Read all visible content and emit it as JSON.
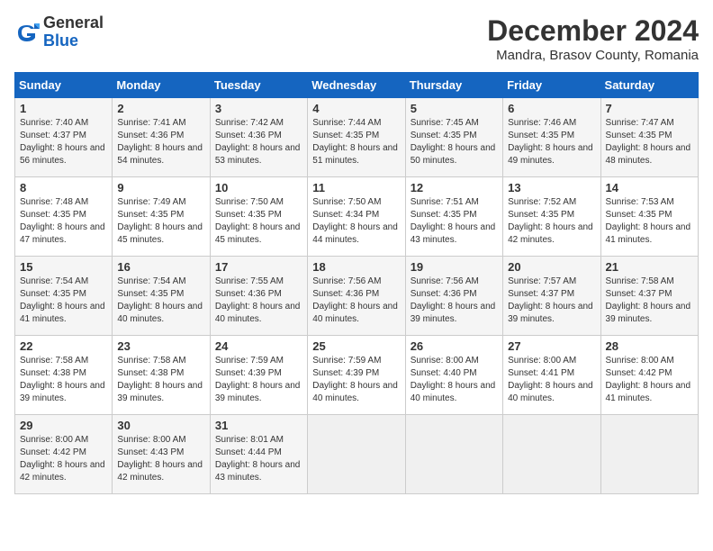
{
  "header": {
    "logo_line1": "General",
    "logo_line2": "Blue",
    "month_year": "December 2024",
    "location": "Mandra, Brasov County, Romania"
  },
  "weekdays": [
    "Sunday",
    "Monday",
    "Tuesday",
    "Wednesday",
    "Thursday",
    "Friday",
    "Saturday"
  ],
  "weeks": [
    [
      {
        "day": "1",
        "sunrise": "7:40 AM",
        "sunset": "4:37 PM",
        "daylight": "8 hours and 56 minutes."
      },
      {
        "day": "2",
        "sunrise": "7:41 AM",
        "sunset": "4:36 PM",
        "daylight": "8 hours and 54 minutes."
      },
      {
        "day": "3",
        "sunrise": "7:42 AM",
        "sunset": "4:36 PM",
        "daylight": "8 hours and 53 minutes."
      },
      {
        "day": "4",
        "sunrise": "7:44 AM",
        "sunset": "4:35 PM",
        "daylight": "8 hours and 51 minutes."
      },
      {
        "day": "5",
        "sunrise": "7:45 AM",
        "sunset": "4:35 PM",
        "daylight": "8 hours and 50 minutes."
      },
      {
        "day": "6",
        "sunrise": "7:46 AM",
        "sunset": "4:35 PM",
        "daylight": "8 hours and 49 minutes."
      },
      {
        "day": "7",
        "sunrise": "7:47 AM",
        "sunset": "4:35 PM",
        "daylight": "8 hours and 48 minutes."
      }
    ],
    [
      {
        "day": "8",
        "sunrise": "7:48 AM",
        "sunset": "4:35 PM",
        "daylight": "8 hours and 47 minutes."
      },
      {
        "day": "9",
        "sunrise": "7:49 AM",
        "sunset": "4:35 PM",
        "daylight": "8 hours and 45 minutes."
      },
      {
        "day": "10",
        "sunrise": "7:50 AM",
        "sunset": "4:35 PM",
        "daylight": "8 hours and 45 minutes."
      },
      {
        "day": "11",
        "sunrise": "7:50 AM",
        "sunset": "4:34 PM",
        "daylight": "8 hours and 44 minutes."
      },
      {
        "day": "12",
        "sunrise": "7:51 AM",
        "sunset": "4:35 PM",
        "daylight": "8 hours and 43 minutes."
      },
      {
        "day": "13",
        "sunrise": "7:52 AM",
        "sunset": "4:35 PM",
        "daylight": "8 hours and 42 minutes."
      },
      {
        "day": "14",
        "sunrise": "7:53 AM",
        "sunset": "4:35 PM",
        "daylight": "8 hours and 41 minutes."
      }
    ],
    [
      {
        "day": "15",
        "sunrise": "7:54 AM",
        "sunset": "4:35 PM",
        "daylight": "8 hours and 41 minutes."
      },
      {
        "day": "16",
        "sunrise": "7:54 AM",
        "sunset": "4:35 PM",
        "daylight": "8 hours and 40 minutes."
      },
      {
        "day": "17",
        "sunrise": "7:55 AM",
        "sunset": "4:36 PM",
        "daylight": "8 hours and 40 minutes."
      },
      {
        "day": "18",
        "sunrise": "7:56 AM",
        "sunset": "4:36 PM",
        "daylight": "8 hours and 40 minutes."
      },
      {
        "day": "19",
        "sunrise": "7:56 AM",
        "sunset": "4:36 PM",
        "daylight": "8 hours and 39 minutes."
      },
      {
        "day": "20",
        "sunrise": "7:57 AM",
        "sunset": "4:37 PM",
        "daylight": "8 hours and 39 minutes."
      },
      {
        "day": "21",
        "sunrise": "7:58 AM",
        "sunset": "4:37 PM",
        "daylight": "8 hours and 39 minutes."
      }
    ],
    [
      {
        "day": "22",
        "sunrise": "7:58 AM",
        "sunset": "4:38 PM",
        "daylight": "8 hours and 39 minutes."
      },
      {
        "day": "23",
        "sunrise": "7:58 AM",
        "sunset": "4:38 PM",
        "daylight": "8 hours and 39 minutes."
      },
      {
        "day": "24",
        "sunrise": "7:59 AM",
        "sunset": "4:39 PM",
        "daylight": "8 hours and 39 minutes."
      },
      {
        "day": "25",
        "sunrise": "7:59 AM",
        "sunset": "4:39 PM",
        "daylight": "8 hours and 40 minutes."
      },
      {
        "day": "26",
        "sunrise": "8:00 AM",
        "sunset": "4:40 PM",
        "daylight": "8 hours and 40 minutes."
      },
      {
        "day": "27",
        "sunrise": "8:00 AM",
        "sunset": "4:41 PM",
        "daylight": "8 hours and 40 minutes."
      },
      {
        "day": "28",
        "sunrise": "8:00 AM",
        "sunset": "4:42 PM",
        "daylight": "8 hours and 41 minutes."
      }
    ],
    [
      {
        "day": "29",
        "sunrise": "8:00 AM",
        "sunset": "4:42 PM",
        "daylight": "8 hours and 42 minutes."
      },
      {
        "day": "30",
        "sunrise": "8:00 AM",
        "sunset": "4:43 PM",
        "daylight": "8 hours and 42 minutes."
      },
      {
        "day": "31",
        "sunrise": "8:01 AM",
        "sunset": "4:44 PM",
        "daylight": "8 hours and 43 minutes."
      },
      null,
      null,
      null,
      null
    ]
  ]
}
